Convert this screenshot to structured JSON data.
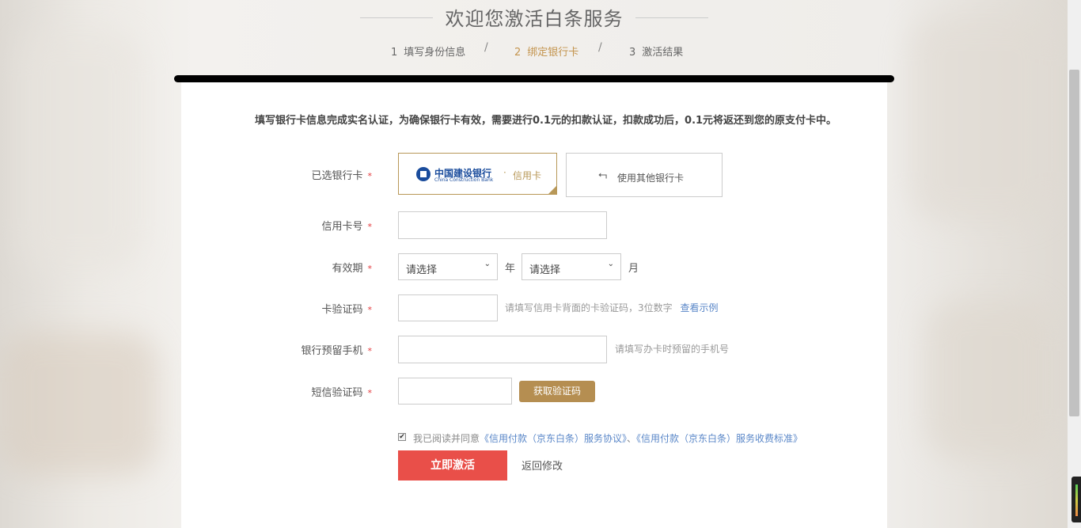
{
  "header": {
    "title": "欢迎您激活白条服务",
    "steps": [
      {
        "num": "1",
        "label": "填写身份信息",
        "active": false
      },
      {
        "num": "2",
        "label": "绑定银行卡",
        "active": true
      },
      {
        "num": "3",
        "label": "激活结果",
        "active": false
      }
    ],
    "separator": "/"
  },
  "notice": "填写银行卡信息完成实名认证，为确保银行卡有效，需要进行0.1元的扣款认证，扣款成功后，0.1元将返还到您的原支付卡中。",
  "form": {
    "required_mark": "*",
    "bank": {
      "label": "已选银行卡",
      "selected_bank": "中国建设银行",
      "selected_bank_en": "China Construction Bank",
      "dot": "·",
      "card_type": "信用卡",
      "other_bank_label": "使用其他银行卡",
      "other_bank_icon": "back-arrow-icon"
    },
    "card_number": {
      "label": "信用卡号",
      "value": "",
      "placeholder": ""
    },
    "expiry": {
      "label": "有效期",
      "year_value": "请选择",
      "year_unit": "年",
      "month_value": "请选择",
      "month_unit": "月"
    },
    "cvv": {
      "label": "卡验证码",
      "value": "",
      "hint": "请填写信用卡背面的卡验证码，3位数字",
      "example_link": "查看示例"
    },
    "phone": {
      "label": "银行预留手机",
      "value": "",
      "hint": "请填写办卡时预留的手机号"
    },
    "sms": {
      "label": "短信验证码",
      "value": "",
      "get_code_button": "获取验证码"
    },
    "agreement": {
      "checked": true,
      "prefix": "我已阅读并同意",
      "link1": "《信用付款（京东白条）服务协议》",
      "joiner": "、",
      "link2": "《信用付款（京东白条）服务收费标准》"
    },
    "submit_button": "立即激活",
    "back_link": "返回修改"
  },
  "colors": {
    "accent_gold": "#b58e51",
    "submit_red": "#e94f49",
    "link_blue": "#5a87c8",
    "required_red": "#e4393c"
  }
}
